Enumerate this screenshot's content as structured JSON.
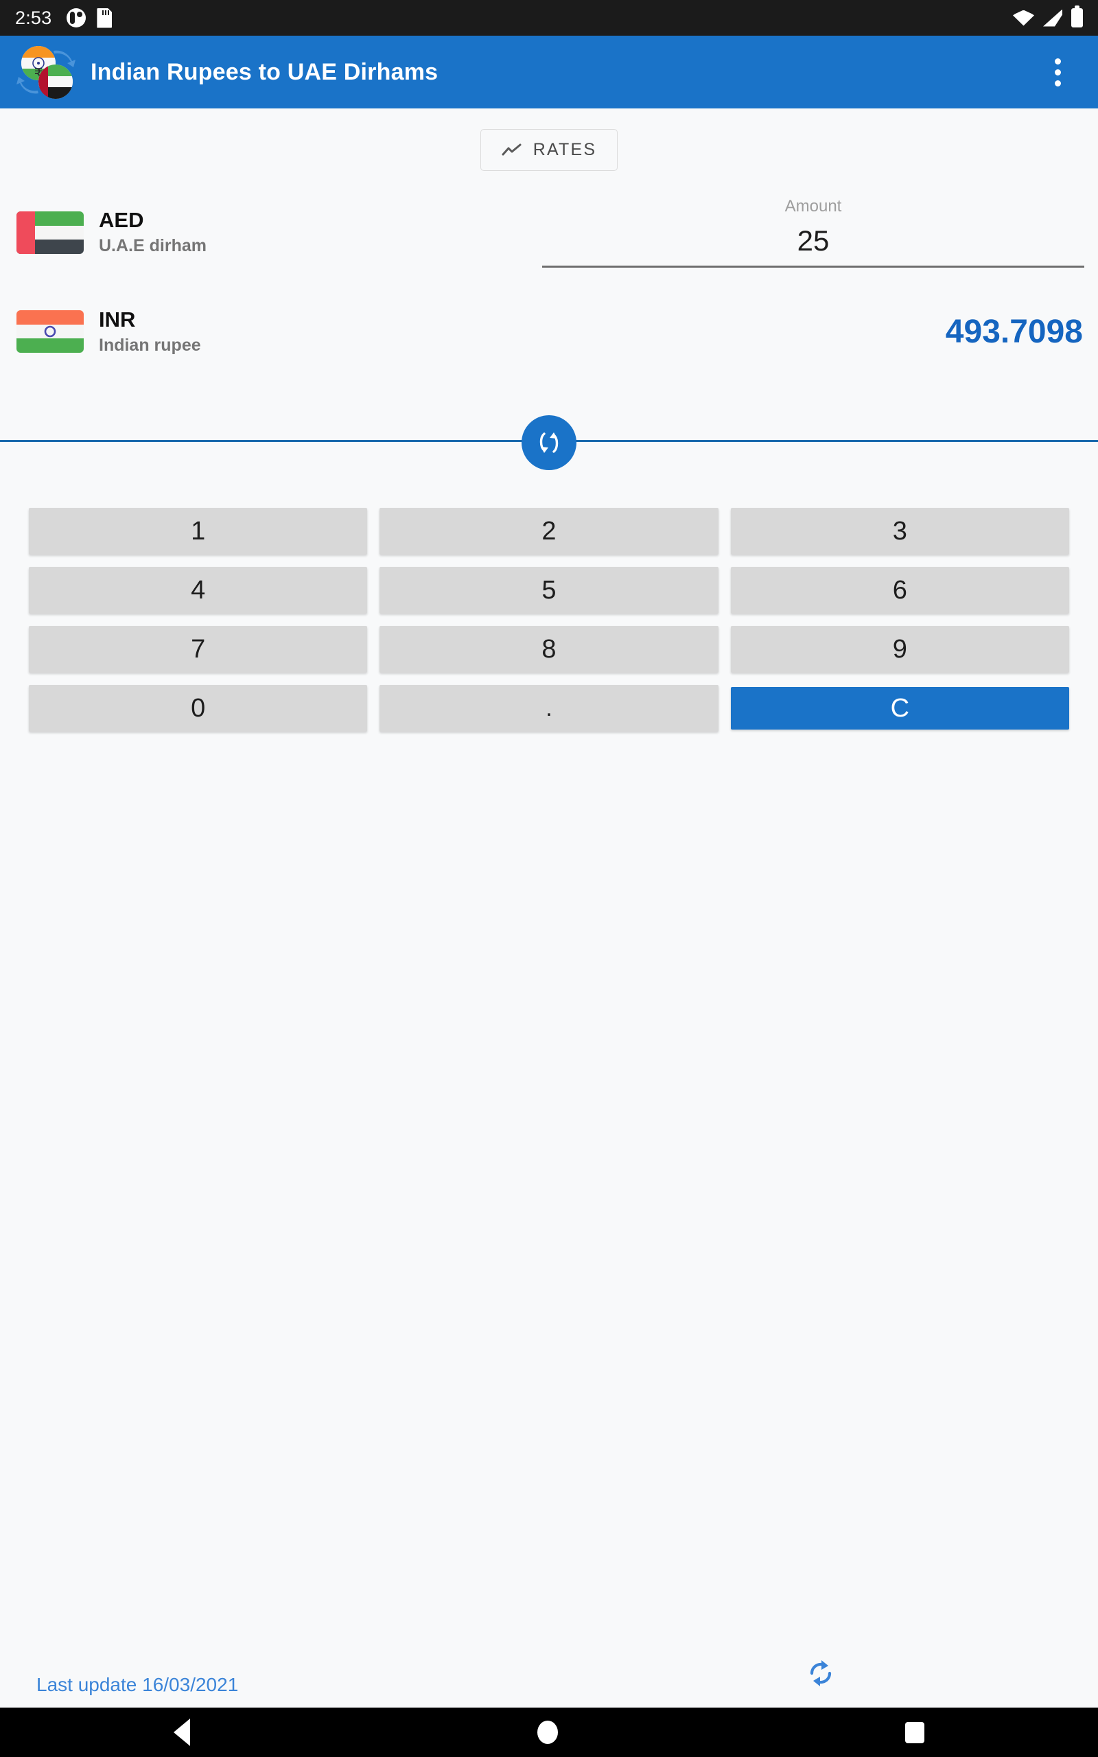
{
  "status_bar": {
    "time": "2:53",
    "left_icons": [
      "do-not-disturb-icon",
      "sd-card-icon"
    ],
    "right_icons": [
      "wifi-icon",
      "cell-signal-icon",
      "battery-icon"
    ]
  },
  "app_bar": {
    "title": "Indian Rupees to UAE Dirhams",
    "logo_icon": "currency-exchange-flags-icon",
    "overflow_icon": "more-vert-icon",
    "background_color": "#1a73c8"
  },
  "rates_button": {
    "label": "RATES",
    "icon": "trending-up-icon"
  },
  "currencies": {
    "from": {
      "code": "AED",
      "name": "U.A.E dirham",
      "flag": "uae-flag-icon"
    },
    "to": {
      "code": "INR",
      "name": "Indian rupee",
      "flag": "india-flag-icon"
    }
  },
  "amount_field": {
    "label": "Amount",
    "value": "25"
  },
  "result": {
    "value": "493.7098",
    "color": "#1565c0"
  },
  "swap_button": {
    "icon": "swap-vertical-icon"
  },
  "keypad": {
    "rows": [
      [
        {
          "label": "1",
          "name": "key-1"
        },
        {
          "label": "2",
          "name": "key-2"
        },
        {
          "label": "3",
          "name": "key-3"
        }
      ],
      [
        {
          "label": "4",
          "name": "key-4"
        },
        {
          "label": "5",
          "name": "key-5"
        },
        {
          "label": "6",
          "name": "key-6"
        }
      ],
      [
        {
          "label": "7",
          "name": "key-7"
        },
        {
          "label": "8",
          "name": "key-8"
        },
        {
          "label": "9",
          "name": "key-9"
        }
      ],
      [
        {
          "label": "0",
          "name": "key-0"
        },
        {
          "label": ".",
          "name": "key-decimal"
        },
        {
          "label": "C",
          "name": "key-clear"
        }
      ]
    ],
    "clear_color": "#1a73c8"
  },
  "footer": {
    "last_update": "Last update 16/03/2021",
    "refresh_icon": "refresh-icon",
    "text_color": "#3b84d8"
  },
  "nav_bar": {
    "back": "back-icon",
    "home": "home-icon",
    "recents": "recents-icon"
  }
}
